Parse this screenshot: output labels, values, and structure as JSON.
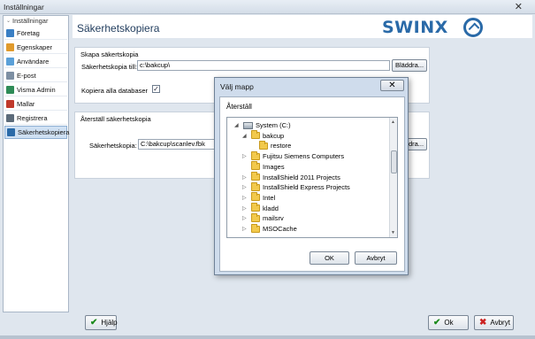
{
  "window": {
    "title": "Inställningar",
    "close_glyph": "✕"
  },
  "sidebar": {
    "header": "Inställningar",
    "items": [
      {
        "label": "Företag",
        "icon": "company-icon",
        "color": "#3a7fc4"
      },
      {
        "label": "Egenskaper",
        "icon": "properties-icon",
        "color": "#e09a2c"
      },
      {
        "label": "Användare",
        "icon": "users-icon",
        "color": "#5aa0d8"
      },
      {
        "label": "E-post",
        "icon": "email-icon",
        "color": "#7d8fa3"
      },
      {
        "label": "Visma Admin",
        "icon": "visma-admin-icon",
        "color": "#2e8b57"
      },
      {
        "label": "Mallar",
        "icon": "templates-icon",
        "color": "#c0392b"
      },
      {
        "label": "Registrera",
        "icon": "register-icon",
        "color": "#5c6b7a"
      },
      {
        "label": "Säkerhetskopiera",
        "icon": "backup-icon",
        "color": "#2a6aa8",
        "active": true
      }
    ]
  },
  "main": {
    "title": "Säkerhetskopiera",
    "logo_text": "SWINX",
    "backup": {
      "legend": "Skapa säkertskopia",
      "path_label": "Säkerhetskopia till:",
      "path_value": "c:\\bakcup\\",
      "browse_label": "Bläddra...",
      "copy_all_label": "Kopiera alla databaser",
      "copy_all_checked": true
    },
    "restore": {
      "legend": "Återställ säkerhetskopia",
      "file_label": "Säkerhetskopia:",
      "file_value": "C:\\bakcup\\scanlev.fbk",
      "browse_label": "Bläddra..."
    }
  },
  "footer": {
    "help_label": "Hjälp",
    "ok_label": "Ok",
    "cancel_label": "Avbryt"
  },
  "dialog": {
    "title": "Välj mapp",
    "close_glyph": "✕",
    "caption": "Återställ",
    "tree": [
      {
        "label": "System (C:)",
        "type": "drive",
        "indent": 0,
        "expanded": true
      },
      {
        "label": "bakcup",
        "type": "folder",
        "indent": 1,
        "expanded": true
      },
      {
        "label": "restore",
        "type": "folder",
        "indent": 2,
        "expanded": null
      },
      {
        "label": "Fujitsu Siemens Computers",
        "type": "folder",
        "indent": 1,
        "expanded": false
      },
      {
        "label": "Images",
        "type": "folder",
        "indent": 1,
        "expanded": null
      },
      {
        "label": "InstallShield 2011 Projects",
        "type": "folder",
        "indent": 1,
        "expanded": false
      },
      {
        "label": "InstallShield Express Projects",
        "type": "folder",
        "indent": 1,
        "expanded": false
      },
      {
        "label": "Intel",
        "type": "folder",
        "indent": 1,
        "expanded": false
      },
      {
        "label": "kladd",
        "type": "folder",
        "indent": 1,
        "expanded": false
      },
      {
        "label": "mailsrv",
        "type": "folder",
        "indent": 1,
        "expanded": false
      },
      {
        "label": "MSOCache",
        "type": "folder",
        "indent": 1,
        "expanded": false
      }
    ],
    "ok_label": "OK",
    "cancel_label": "Avbryt"
  }
}
